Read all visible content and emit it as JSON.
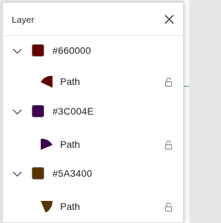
{
  "panel": {
    "title": "Layer"
  },
  "layers": [
    {
      "color_label": "#660000",
      "swatch_color": "#660000",
      "children": [
        {
          "label": "Path",
          "fill": "#660000",
          "locked": false
        }
      ]
    },
    {
      "color_label": "#3C004E",
      "swatch_color": "#3C004E",
      "children": [
        {
          "label": "Path",
          "fill": "#3C004E",
          "locked": false
        }
      ]
    },
    {
      "color_label": "#5A3400",
      "swatch_color": "#5A3400",
      "children": [
        {
          "label": "Path",
          "fill": "#5A3400",
          "locked": false
        }
      ]
    }
  ],
  "icons": {
    "close": "close-icon",
    "chevron": "chevron-down-icon",
    "lock": "unlock-icon"
  }
}
